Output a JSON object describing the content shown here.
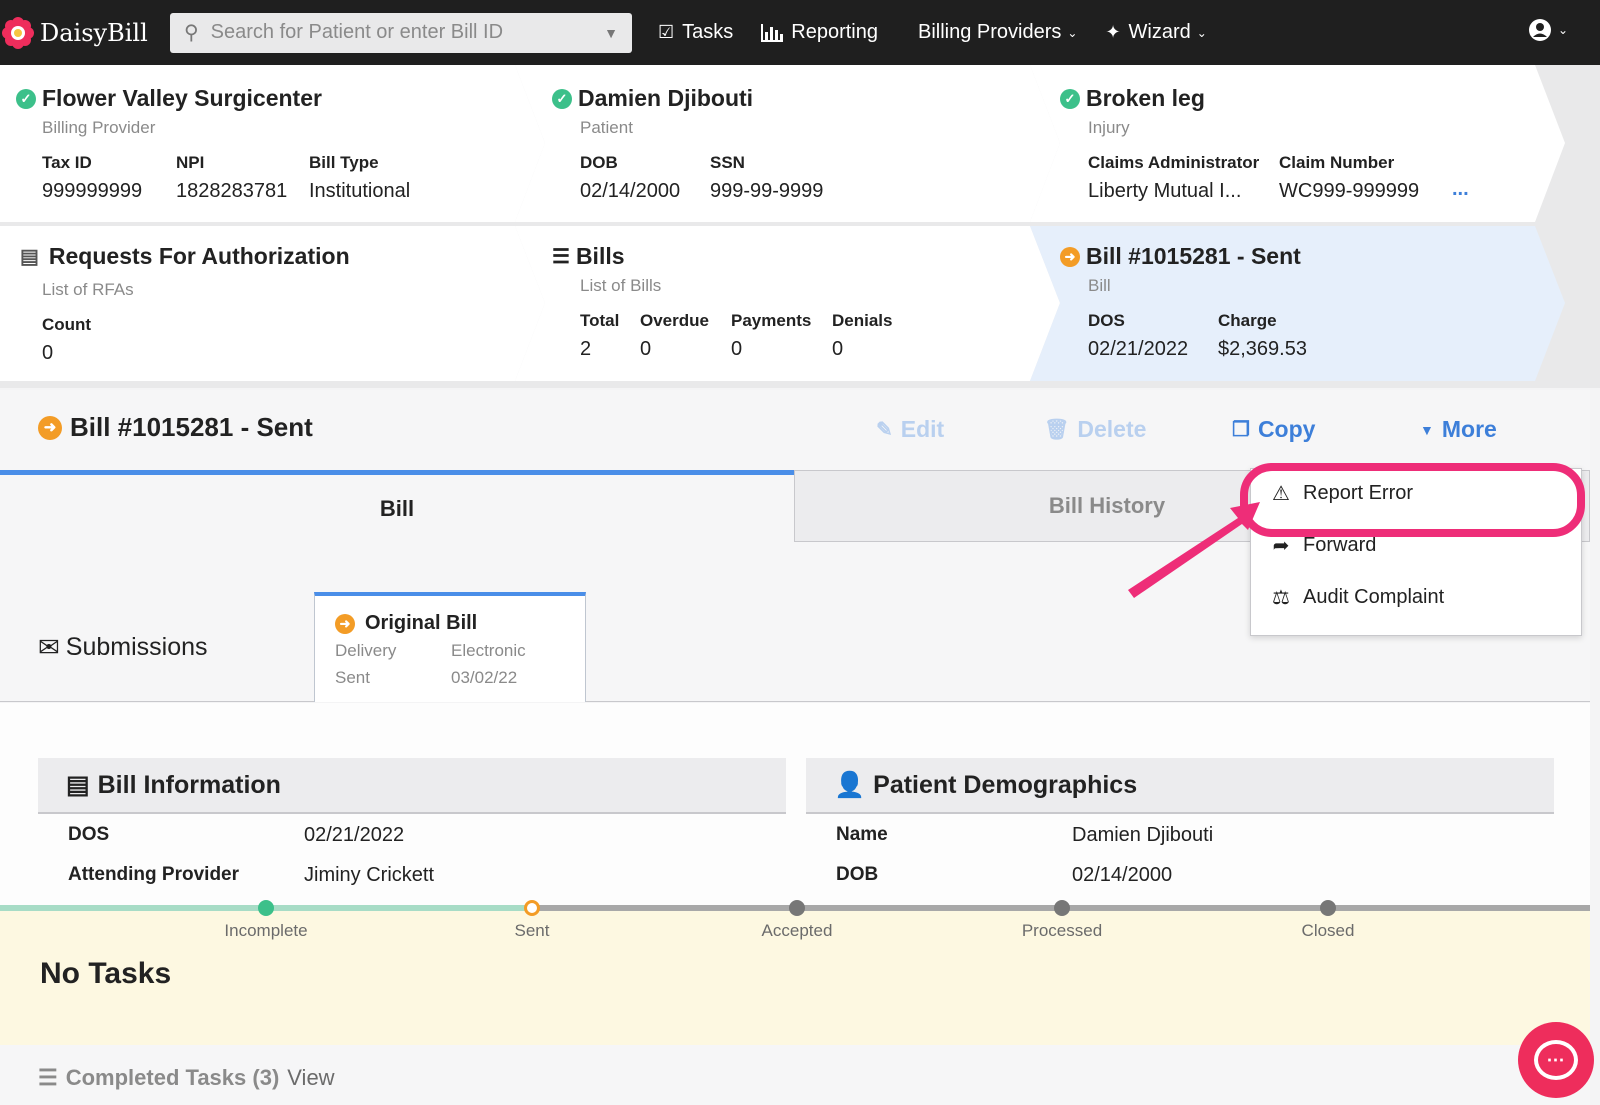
{
  "nav": {
    "logo": "DaisyBill",
    "search_placeholder": "Search for Patient or enter Bill ID",
    "tasks": "Tasks",
    "reporting": "Reporting",
    "billing_providers": "Billing Providers",
    "wizard": "Wizard"
  },
  "cards": {
    "provider": {
      "title": "Flower Valley Surgicenter",
      "sub": "Billing Provider",
      "tax_id_label": "Tax ID",
      "tax_id": "999999999",
      "npi_label": "NPI",
      "npi": "1828283781",
      "bill_type_label": "Bill Type",
      "bill_type": "Institutional"
    },
    "patient": {
      "title": "Damien Djibouti",
      "sub": "Patient",
      "dob_label": "DOB",
      "dob": "02/14/2000",
      "ssn_label": "SSN",
      "ssn": "999-99-9999"
    },
    "injury": {
      "title": "Broken leg",
      "sub": "Injury",
      "admin_label": "Claims Administrator",
      "admin": "Liberty Mutual I...",
      "claim_label": "Claim Number",
      "claim": "WC999-999999",
      "more": "..."
    },
    "rfa": {
      "title": "Requests For Authorization",
      "sub": "List of RFAs",
      "count_label": "Count",
      "count": "0"
    },
    "bills": {
      "title": "Bills",
      "sub": "List of Bills",
      "total_label": "Total",
      "total": "2",
      "overdue_label": "Overdue",
      "overdue": "0",
      "payments_label": "Payments",
      "payments": "0",
      "denials_label": "Denials",
      "denials": "0"
    },
    "bill": {
      "title": "Bill #1015281 - Sent",
      "sub": "Bill",
      "dos_label": "DOS",
      "dos": "02/21/2022",
      "charge_label": "Charge",
      "charge": "$2,369.53"
    }
  },
  "billbar": {
    "title": "Bill #1015281 - Sent",
    "edit": "Edit",
    "delete": "Delete",
    "copy": "Copy",
    "more": "More"
  },
  "tabs": {
    "bill": "Bill",
    "history": "Bill History"
  },
  "submissions": {
    "label": "Submissions",
    "card": {
      "title": "Original Bill",
      "delivery_label": "Delivery",
      "delivery": "Electronic",
      "sent_label": "Sent",
      "sent": "03/02/22"
    }
  },
  "bill_info": {
    "title": "Bill Information",
    "dos_label": "DOS",
    "dos": "02/21/2022",
    "provider_label": "Attending Provider",
    "provider": "Jiminy Crickett"
  },
  "demographics": {
    "title": "Patient Demographics",
    "name_label": "Name",
    "name": "Damien Djibouti",
    "dob_label": "DOB",
    "dob": "02/14/2000"
  },
  "progress": {
    "steps": [
      "Incomplete",
      "Sent",
      "Accepted",
      "Processed",
      "Closed"
    ]
  },
  "tasks": {
    "none": "No Tasks",
    "completed": "Completed Tasks (3)",
    "view": "View"
  },
  "menu": {
    "report_error": "Report Error",
    "forward": "Forward",
    "audit_complaint": "Audit Complaint"
  },
  "colors": {
    "accent": "#3d7fd9",
    "highlight": "#ee2d78",
    "check": "#3cc08a",
    "sent": "#f39c26"
  }
}
